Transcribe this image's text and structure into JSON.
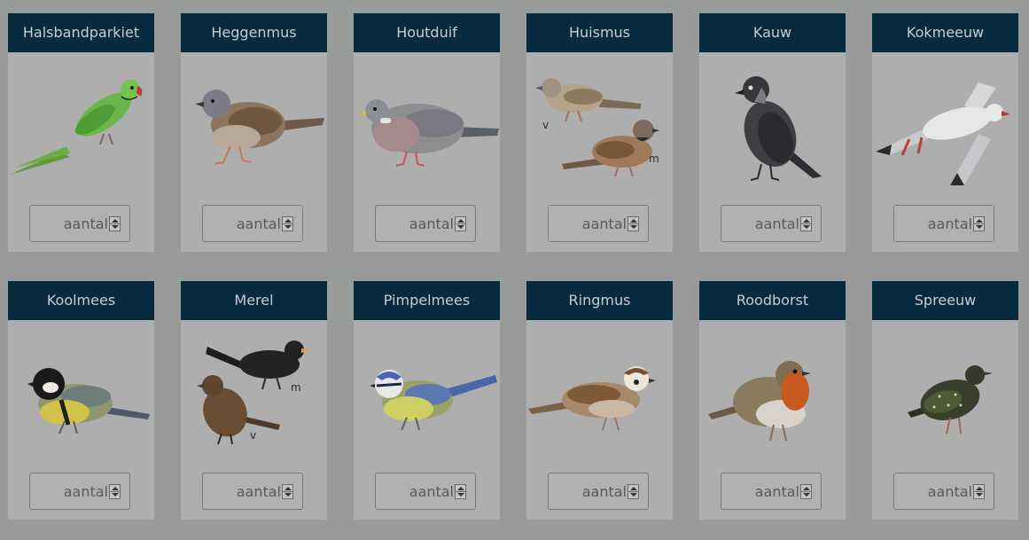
{
  "quantity_placeholder": "aantal",
  "birds": [
    {
      "name": "Halsbandparkiet",
      "icon": "ring-necked-parakeet-illustration"
    },
    {
      "name": "Heggenmus",
      "icon": "dunnock-illustration"
    },
    {
      "name": "Houtduif",
      "icon": "wood-pigeon-illustration"
    },
    {
      "name": "Huismus",
      "icon": "house-sparrow-illustration",
      "labels": [
        "v",
        "m"
      ]
    },
    {
      "name": "Kauw",
      "icon": "jackdaw-illustration"
    },
    {
      "name": "Kokmeeuw",
      "icon": "black-headed-gull-illustration"
    },
    {
      "name": "Koolmees",
      "icon": "great-tit-illustration"
    },
    {
      "name": "Merel",
      "icon": "blackbird-illustration",
      "labels": [
        "m",
        "v"
      ]
    },
    {
      "name": "Pimpelmees",
      "icon": "blue-tit-illustration"
    },
    {
      "name": "Ringmus",
      "icon": "tree-sparrow-illustration"
    },
    {
      "name": "Roodborst",
      "icon": "robin-illustration"
    },
    {
      "name": "Spreeuw",
      "icon": "starling-illustration"
    }
  ]
}
